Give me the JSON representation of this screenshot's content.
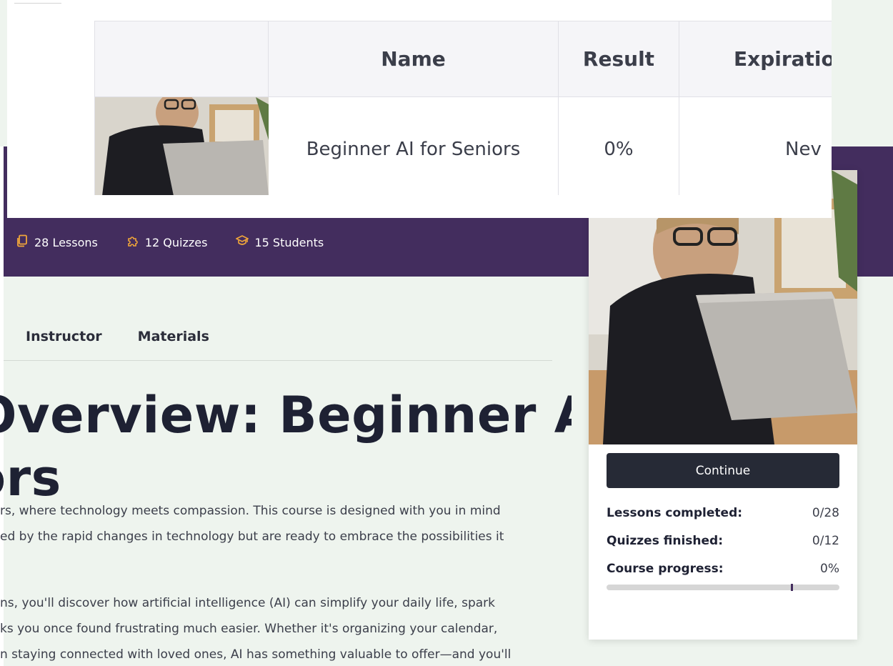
{
  "hero": {
    "stats": [
      {
        "icon": "lessons-icon",
        "label": "28 Lessons"
      },
      {
        "icon": "quiz-puzzle-icon",
        "label": "12 Quizzes"
      },
      {
        "icon": "graduation-cap-icon",
        "label": "15 Students"
      }
    ]
  },
  "tabs": [
    "Instructor",
    "Materials"
  ],
  "overview": {
    "title_line1": "Overview: Beginner AI",
    "title_line2": "ors",
    "paragraph1": [
      "rs, where technology meets compassion. This course is designed with you in mind",
      "ed by the rapid changes in technology but are ready to embrace the possibilities it"
    ],
    "paragraph2": [
      "ns, you'll discover how artificial intelligence (AI) can simplify your daily life, spark",
      "ks you once found frustrating much easier. Whether it's organizing your calendar,",
      "n staying connected with loved ones, AI has something valuable to offer—and you'll"
    ]
  },
  "sidebar_card": {
    "button_label": "Continue",
    "stats": [
      {
        "label": "Lessons completed:",
        "value": "0/28"
      },
      {
        "label": "Quizzes finished:",
        "value": "0/12"
      },
      {
        "label": "Course progress:",
        "value": "0%"
      }
    ],
    "progress_fraction": 0.0
  },
  "results_table": {
    "headers": [
      "",
      "Name",
      "Result",
      "Expiratio"
    ],
    "rows": [
      {
        "name": "Beginner AI for Seniors",
        "result": "0%",
        "expiration": "Nev"
      }
    ]
  },
  "colors": {
    "hero_purple": "#432d5e",
    "accent_orange": "#f0a63a",
    "page_bg": "#eef4ee",
    "button_dark": "#262a36"
  }
}
